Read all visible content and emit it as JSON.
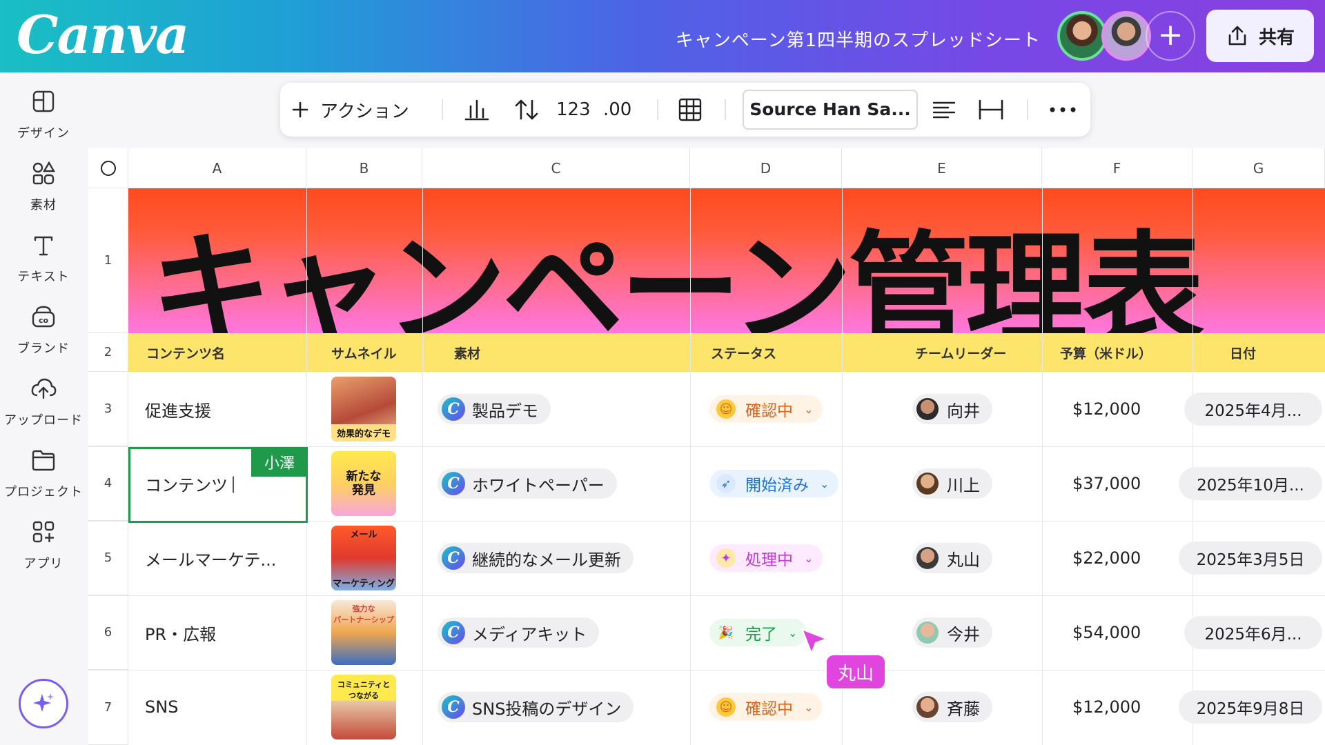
{
  "app": {
    "logo": "Canva",
    "doc_title": "キャンペーン第1四半期のスプレッドシート",
    "share_label": "共有",
    "add_label": "+"
  },
  "sidebar": {
    "items": [
      {
        "label": "デザイン",
        "icon": "layout-icon"
      },
      {
        "label": "素材",
        "icon": "elements-icon"
      },
      {
        "label": "テキスト",
        "icon": "text-icon"
      },
      {
        "label": "ブランド",
        "icon": "brand-icon"
      },
      {
        "label": "アップロード",
        "icon": "upload-icon"
      },
      {
        "label": "プロジェクト",
        "icon": "folder-icon"
      },
      {
        "label": "アプリ",
        "icon": "apps-icon"
      }
    ]
  },
  "toolbar": {
    "action_label": "アクション",
    "number_format": "123",
    "decimal_format": ".00",
    "font_name": "Source Han Sa..."
  },
  "sheet": {
    "columns": [
      "A",
      "B",
      "C",
      "D",
      "E",
      "F",
      "G"
    ],
    "rows": [
      "1",
      "2",
      "3",
      "4",
      "5",
      "6",
      "7"
    ],
    "banner_title": "キャンペーン管理表",
    "headers": [
      "コンテンツ名",
      "サムネイル",
      "素材",
      "ステータス",
      "チームリーダー",
      "予算（米ドル）",
      "日付"
    ],
    "data": [
      {
        "name": "促進支援",
        "thumb": "効果的なデモ",
        "asset": "製品デモ",
        "status": "確認中",
        "leader": "向井",
        "budget": "$12,000",
        "date": "2025年4月..."
      },
      {
        "name": "コンテンツ",
        "thumb": "新たな発見",
        "asset": "ホワイトペーパー",
        "status": "開始済み",
        "leader": "川上",
        "budget": "$37,000",
        "date": "2025年10月..."
      },
      {
        "name": "メールマーケテ...",
        "thumb": "メール マーケティング",
        "asset": "継続的なメール更新",
        "status": "処理中",
        "leader": "丸山",
        "budget": "$22,000",
        "date": "2025年3月5日"
      },
      {
        "name": "PR・広報",
        "thumb": "強力な パートナーシップ",
        "asset": "メディアキット",
        "status": "完了",
        "leader": "今井",
        "budget": "$54,000",
        "date": "2025年6月..."
      },
      {
        "name": "SNS",
        "thumb": "コミュニティと つながる",
        "asset": "SNS投稿のデザイン",
        "status": "確認中",
        "leader": "斉藤",
        "budget": "$12,000",
        "date": "2025年9月8日"
      }
    ],
    "thumb_top": [
      "",
      "",
      "メール",
      "強力な",
      "コミュニティと"
    ],
    "thumb_bottom": [
      "効果的なデモ",
      "",
      "マーケティング",
      "パートナーシップ",
      "つながる"
    ],
    "thumb_mid": [
      "",
      "新たな\n発見",
      "",
      "",
      ""
    ]
  },
  "collab": {
    "selection_user": "小澤",
    "cursor_user": "丸山"
  },
  "colors": {
    "banner_top": "#ff4a1d",
    "banner_bottom": "#ff77df",
    "header_row": "#fde56b",
    "selection": "#1f9a4a",
    "cursor": "#e045e0"
  }
}
